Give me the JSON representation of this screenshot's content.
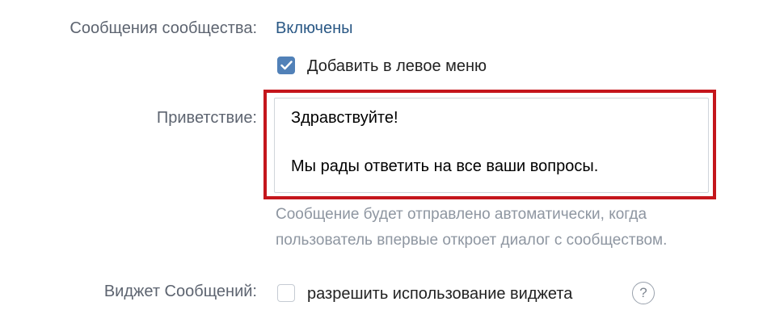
{
  "messages_setting": {
    "label": "Сообщения сообщества:",
    "value": "Включены",
    "add_to_left_menu": {
      "label": "Добавить в левое меню",
      "checked": true
    }
  },
  "greeting": {
    "label": "Приветствие:",
    "line1": "Здравствуйте!",
    "line2": "Мы рады ответить на все ваши вопросы.",
    "hint_line1": "Сообщение будет отправлено автоматически, когда",
    "hint_line2": "пользователь впервые откроет диалог с сообществом."
  },
  "widget": {
    "label": "Виджет Сообщений:",
    "checkbox_label": "разрешить использование виджета",
    "checked": false,
    "help_icon": "?"
  },
  "colors": {
    "label": "#5d6470",
    "link": "#2a5885",
    "checkbox_checked": "#5181b8",
    "highlight": "#c4161c",
    "hint": "#8e96a1"
  }
}
